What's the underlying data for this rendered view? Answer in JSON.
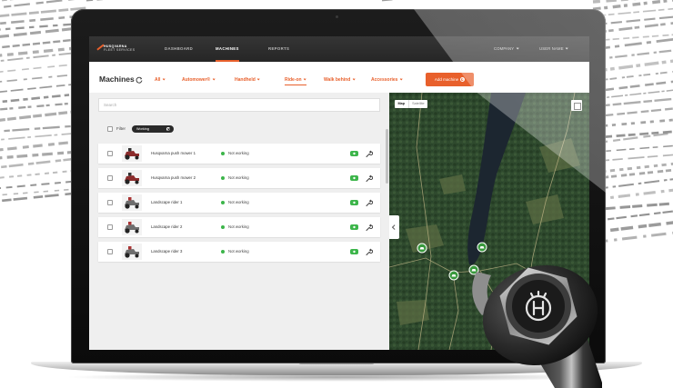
{
  "app": {
    "logo": {
      "line1": "HUSQVARNA",
      "line2": "FLEET SERVICES"
    },
    "nav": {
      "items": [
        {
          "label": "DASHBOARD",
          "active": false
        },
        {
          "label": "MACHINES",
          "active": true
        },
        {
          "label": "REPORTS",
          "active": false
        }
      ],
      "company_menu": "COMPANY",
      "user_menu": "USER NAME"
    },
    "colors": {
      "accent": "#e8602c",
      "nav_background": "#2b2b2b",
      "status_green": "#3cb54a",
      "map_marker": "#3a9a3e"
    }
  },
  "page": {
    "title": "Machines",
    "title_icon": "refresh-icon",
    "filters": [
      {
        "label": "All",
        "active": false
      },
      {
        "label": "Automower®",
        "active": false
      },
      {
        "label": "Handheld",
        "active": false
      },
      {
        "label": "Ride-on",
        "active": true
      },
      {
        "label": "Walk behind",
        "active": false
      },
      {
        "label": "Accessories",
        "active": false
      }
    ],
    "add_button_label": "Add machine"
  },
  "machine_list": {
    "search_placeholder": "Search",
    "filter_label": "Filter",
    "active_filter_chip": "Working",
    "row_icons": [
      "connectivity-icon",
      "wrench-icon"
    ],
    "rows": [
      {
        "name": "Husqvarna push mower 1",
        "status": "Not working"
      },
      {
        "name": "Husqvarna push mower 2",
        "status": "Not working"
      },
      {
        "name": "Landscape rider 1",
        "status": "Not working"
      },
      {
        "name": "Landscape rider 2",
        "status": "Not working"
      },
      {
        "name": "Landscape rider 3",
        "status": "Not working"
      }
    ]
  },
  "map": {
    "view_options": [
      {
        "label": "Map",
        "selected": true
      },
      {
        "label": "Satellite",
        "selected": false
      }
    ]
  }
}
